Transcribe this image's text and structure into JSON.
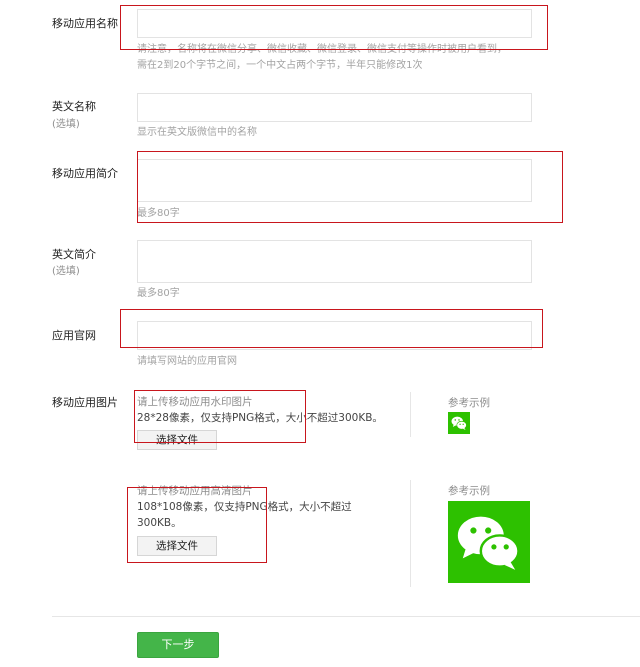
{
  "fields": {
    "app_name": {
      "label": "移动应用名称",
      "hint_line1": "请注意，名称将在微信分享、微信收藏、微信登录、微信支付等操作时被用户看到，",
      "hint_line2": "需在2到20个字节之间，一个中文占两个字节，半年只能修改1次",
      "value": ""
    },
    "en_name": {
      "label": "英文名称",
      "optional": "(选填)",
      "hint": "显示在英文版微信中的名称",
      "value": ""
    },
    "app_intro": {
      "label": "移动应用简介",
      "hint": "最多80字",
      "value": ""
    },
    "en_intro": {
      "label": "英文简介",
      "optional": "(选填)",
      "hint": "最多80字",
      "value": ""
    },
    "website": {
      "label": "应用官网",
      "hint": "请填写网站的应用官网",
      "value": ""
    }
  },
  "images": {
    "label": "移动应用图片",
    "watermark": {
      "title": "请上传移动应用水印图片",
      "desc": "28*28像素，仅支持PNG格式，大小不超过300KB。",
      "button": "选择文件",
      "ref_title": "参考示例"
    },
    "hd": {
      "title": "请上传移动应用高清图片",
      "desc_line1": "108*108像素，仅支持PNG格式，大小不超过",
      "desc_line2": "300KB。",
      "button": "选择文件",
      "ref_title": "参考示例"
    }
  },
  "next_button": "下一步",
  "colors": {
    "accent_green": "#44b549",
    "wechat_green": "#2dc100",
    "highlight_red": "#c8161d"
  },
  "icons": {
    "small_example": "wechat-logo-icon",
    "large_example": "wechat-logo-icon"
  }
}
